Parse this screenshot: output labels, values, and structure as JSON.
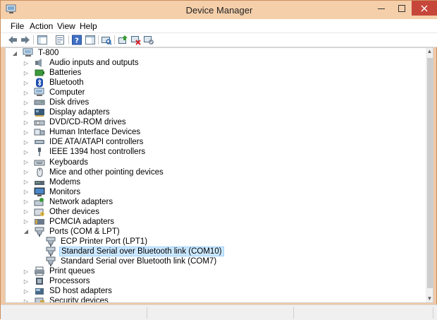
{
  "window": {
    "title": "Device Manager"
  },
  "menu": {
    "items": [
      "File",
      "Action",
      "View",
      "Help"
    ]
  },
  "tree": {
    "root": "T-800",
    "items": [
      {
        "label": "Audio inputs and outputs",
        "icon": "speaker-icon",
        "expanded": false
      },
      {
        "label": "Batteries",
        "icon": "battery-icon",
        "expanded": false
      },
      {
        "label": "Bluetooth",
        "icon": "bluetooth-icon",
        "expanded": false
      },
      {
        "label": "Computer",
        "icon": "computer-icon",
        "expanded": false
      },
      {
        "label": "Disk drives",
        "icon": "disk-drive-icon",
        "expanded": false
      },
      {
        "label": "Display adapters",
        "icon": "display-adapter-icon",
        "expanded": false
      },
      {
        "label": "DVD/CD-ROM drives",
        "icon": "dvd-drive-icon",
        "expanded": false
      },
      {
        "label": "Human Interface Devices",
        "icon": "hid-icon",
        "expanded": false
      },
      {
        "label": "IDE ATA/ATAPI controllers",
        "icon": "ide-controller-icon",
        "expanded": false
      },
      {
        "label": "IEEE 1394 host controllers",
        "icon": "ieee1394-icon",
        "expanded": false
      },
      {
        "label": "Keyboards",
        "icon": "keyboard-icon",
        "expanded": false
      },
      {
        "label": "Mice and other pointing devices",
        "icon": "mouse-icon",
        "expanded": false
      },
      {
        "label": "Modems",
        "icon": "modem-icon",
        "expanded": false
      },
      {
        "label": "Monitors",
        "icon": "monitor-icon",
        "expanded": false
      },
      {
        "label": "Network adapters",
        "icon": "network-adapter-icon",
        "expanded": false
      },
      {
        "label": "Other devices",
        "icon": "other-devices-icon",
        "expanded": false
      },
      {
        "label": "PCMCIA adapters",
        "icon": "pcmcia-icon",
        "expanded": false
      },
      {
        "label": "Ports (COM & LPT)",
        "icon": "port-icon",
        "expanded": true,
        "children": [
          {
            "label": "ECP Printer Port (LPT1)",
            "icon": "port-icon",
            "selected": false
          },
          {
            "label": "Standard Serial over Bluetooth link (COM10)",
            "icon": "port-icon",
            "selected": true
          },
          {
            "label": "Standard Serial over Bluetooth link (COM7)",
            "icon": "port-icon",
            "selected": false
          }
        ]
      },
      {
        "label": "Print queues",
        "icon": "printer-icon",
        "expanded": false
      },
      {
        "label": "Processors",
        "icon": "processor-icon",
        "expanded": false
      },
      {
        "label": "SD host adapters",
        "icon": "sd-adapter-icon",
        "expanded": false
      },
      {
        "label": "Security devices",
        "icon": "security-device-icon",
        "expanded": false
      }
    ]
  },
  "toolbar": {
    "buttons": [
      {
        "name": "back-button",
        "icon": "arrow-left-icon"
      },
      {
        "name": "forward-button",
        "icon": "arrow-right-icon"
      },
      {
        "name": "show-hide-console-tree-button",
        "icon": "console-tree-icon"
      },
      {
        "name": "properties-button",
        "icon": "properties-icon"
      },
      {
        "name": "help-button",
        "icon": "help-icon"
      },
      {
        "name": "show-action-pane-button",
        "icon": "action-pane-icon"
      },
      {
        "name": "scan-hardware-button",
        "icon": "scan-hardware-icon"
      },
      {
        "name": "update-driver-button",
        "icon": "update-driver-icon"
      },
      {
        "name": "uninstall-button",
        "icon": "uninstall-icon"
      },
      {
        "name": "enable-device-button",
        "icon": "enable-device-icon"
      }
    ]
  },
  "colors": {
    "titlebar": "#f5cfaa",
    "close_button": "#c7463a",
    "selection": "#cce8ff"
  }
}
